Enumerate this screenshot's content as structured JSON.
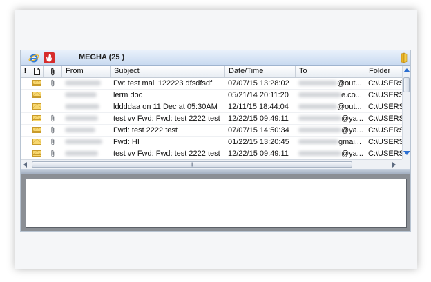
{
  "toolbar": {
    "mailbox_title": "MEGHA (25 )",
    "icons": [
      "internet-explorer-icon",
      "hand-icon",
      "folder-icon"
    ]
  },
  "columns": {
    "flag": "!",
    "type": "document-icon",
    "attachment": "paperclip-icon",
    "from": "From",
    "subject": "Subject",
    "date": "Date/Time",
    "to": "To",
    "folder": "Folder"
  },
  "messages": [
    {
      "subject": "Fw: test mail 122223 dfsdfsdf",
      "date": "07/07/15 13:28:02",
      "to_suffix": "@out...",
      "folder": "C:\\USERS",
      "attachment": true
    },
    {
      "subject": "lerm doc",
      "date": "05/21/14 20:11:20",
      "to_suffix": "e.co...",
      "folder": "C:\\USERS",
      "attachment": false
    },
    {
      "subject": "lddddaa on 11 Dec at 05:30AM",
      "date": "12/11/15 18:44:04",
      "to_suffix": "@out...",
      "folder": "C:\\USERS",
      "attachment": false
    },
    {
      "subject": "test vv Fwd: Fwd: test 2222 test",
      "date": "12/22/15 09:49:11",
      "to_suffix": "@ya...",
      "folder": "C:\\USERS",
      "attachment": true
    },
    {
      "subject": "Fwd: test 2222 test",
      "date": "07/07/15 14:50:34",
      "to_suffix": "@ya...",
      "folder": "C:\\USERS",
      "attachment": true
    },
    {
      "subject": "Fwd: HI",
      "date": "01/22/15 13:20:45",
      "to_suffix": "gmai...",
      "folder": "C:\\USERS",
      "attachment": true
    },
    {
      "subject": "test vv Fwd: Fwd: test 2222 test",
      "date": "12/22/15 09:49:11",
      "to_suffix": "@ya...",
      "folder": "C:\\USERS",
      "attachment": true
    }
  ],
  "colors": {
    "accent": "#2c6fd1",
    "envelope": "#f7d770",
    "header_bg": "#dbe6f4"
  }
}
